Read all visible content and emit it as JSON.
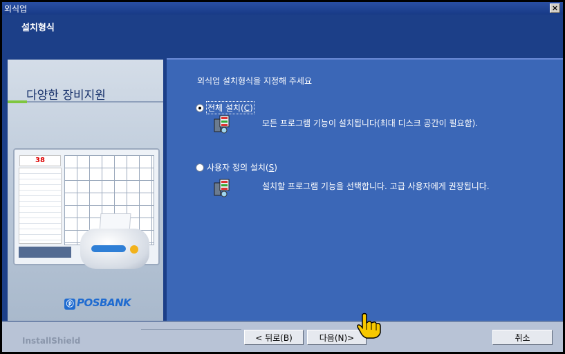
{
  "window": {
    "title": "외식업",
    "close_label": "×",
    "subtitle": "설치형식"
  },
  "left_panel": {
    "heading": "다양한 장비지원",
    "screen_number": "38",
    "logo_text": "POSBANK",
    "logo_mark": "ⓟ"
  },
  "main": {
    "prompt": "외식업 설치형식을 지정해 주세요",
    "options": [
      {
        "label_main": "전체 설치(",
        "label_key": "C",
        "label_end": ")",
        "checked": true,
        "description": "모든 프로그램 기능이 설치됩니다(최대 디스크 공간이 필요함)."
      },
      {
        "label_main": "사용자 정의 설치(",
        "label_key": "S",
        "label_end": ")",
        "checked": false,
        "description": "설치할 프로그램 기능을 선택합니다. 고급 사용자에게 권장됩니다."
      }
    ]
  },
  "footer": {
    "brand": "InstallShield",
    "back_button": "< 뒤로(B)",
    "next_button": "다음(N)>",
    "cancel_button": "취소"
  },
  "colors": {
    "accent": "#3b67b7",
    "dark_blue": "#1c3f88"
  },
  "icons": {
    "setup": "setup-icon",
    "cursor": "hand-pointer-icon"
  }
}
